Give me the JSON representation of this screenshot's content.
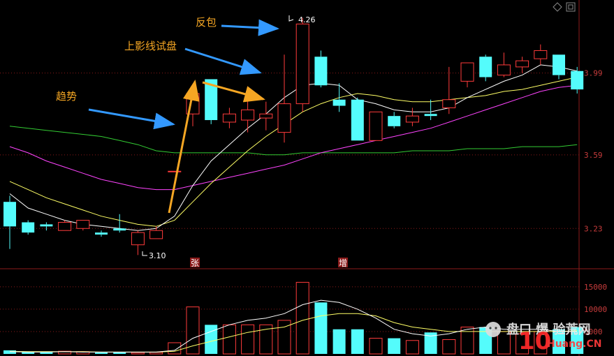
{
  "chart_data": {
    "type": "candlestick",
    "price_ylim": [
      3.05,
      4.32
    ],
    "price_ticks": [
      "3.99",
      "3.59",
      "3.23"
    ],
    "volume_ticks": [
      "15000",
      "10000",
      "5000"
    ],
    "candles": [
      {
        "o": 3.36,
        "h": 3.39,
        "l": 3.13,
        "c": 3.24
      },
      {
        "o": 3.26,
        "h": 3.27,
        "l": 3.2,
        "c": 3.21
      },
      {
        "o": 3.25,
        "h": 3.26,
        "l": 3.22,
        "c": 3.24
      },
      {
        "o": 3.22,
        "h": 3.27,
        "l": 3.22,
        "c": 3.26
      },
      {
        "o": 3.23,
        "h": 3.27,
        "l": 3.22,
        "c": 3.27
      },
      {
        "o": 3.21,
        "h": 3.22,
        "l": 3.19,
        "c": 3.2
      },
      {
        "o": 3.23,
        "h": 3.3,
        "l": 3.21,
        "c": 3.22
      },
      {
        "o": 3.15,
        "h": 3.22,
        "l": 3.1,
        "c": 3.21
      },
      {
        "o": 3.18,
        "h": 3.24,
        "l": 3.18,
        "c": 3.22
      },
      {
        "o": 3.51,
        "h": 3.51,
        "l": 3.51,
        "c": 3.51
      },
      {
        "o": 3.79,
        "h": 3.89,
        "l": 3.73,
        "c": 3.89
      },
      {
        "o": 3.96,
        "h": 3.96,
        "l": 3.74,
        "c": 3.76
      },
      {
        "o": 3.75,
        "h": 3.82,
        "l": 3.72,
        "c": 3.79
      },
      {
        "o": 3.76,
        "h": 3.87,
        "l": 3.7,
        "c": 3.81
      },
      {
        "o": 3.77,
        "h": 3.85,
        "l": 3.71,
        "c": 3.79
      },
      {
        "o": 3.7,
        "h": 4.08,
        "l": 3.65,
        "c": 3.84
      },
      {
        "o": 3.84,
        "h": 4.26,
        "l": 3.8,
        "c": 4.23
      },
      {
        "o": 4.07,
        "h": 4.1,
        "l": 3.92,
        "c": 3.93
      },
      {
        "o": 3.86,
        "h": 3.94,
        "l": 3.8,
        "c": 3.83
      },
      {
        "o": 3.86,
        "h": 3.87,
        "l": 3.66,
        "c": 3.66
      },
      {
        "o": 3.66,
        "h": 3.8,
        "l": 3.66,
        "c": 3.8
      },
      {
        "o": 3.78,
        "h": 3.8,
        "l": 3.72,
        "c": 3.73
      },
      {
        "o": 3.75,
        "h": 3.82,
        "l": 3.73,
        "c": 3.78
      },
      {
        "o": 3.79,
        "h": 3.86,
        "l": 3.76,
        "c": 3.78
      },
      {
        "o": 3.82,
        "h": 4.02,
        "l": 3.79,
        "c": 3.86
      },
      {
        "o": 3.95,
        "h": 4.04,
        "l": 3.92,
        "c": 4.04
      },
      {
        "o": 4.07,
        "h": 4.08,
        "l": 3.95,
        "c": 3.97
      },
      {
        "o": 3.98,
        "h": 4.09,
        "l": 3.97,
        "c": 4.03
      },
      {
        "o": 4.02,
        "h": 4.07,
        "l": 3.99,
        "c": 4.05
      },
      {
        "o": 4.06,
        "h": 4.13,
        "l": 4.03,
        "c": 4.1
      },
      {
        "o": 4.08,
        "h": 4.08,
        "l": 3.96,
        "c": 3.98
      },
      {
        "o": 4.0,
        "h": 4.02,
        "l": 3.89,
        "c": 3.91
      }
    ],
    "volumes": [
      800,
      500,
      400,
      600,
      500,
      300,
      400,
      300,
      350,
      2500,
      10500,
      6500,
      6500,
      6500,
      6500,
      7500,
      16000,
      11500,
      5500,
      5500,
      3500,
      3500,
      3000,
      4800,
      3200,
      6000,
      6000,
      5000,
      4500,
      5000,
      5500,
      6000
    ],
    "ma_white": [
      3.4,
      3.33,
      3.3,
      3.27,
      3.25,
      3.24,
      3.23,
      3.22,
      3.23,
      3.29,
      3.44,
      3.56,
      3.64,
      3.72,
      3.79,
      3.87,
      3.93,
      3.94,
      3.93,
      3.86,
      3.84,
      3.81,
      3.8,
      3.8,
      3.82,
      3.87,
      3.91,
      3.95,
      3.98,
      4.03,
      4.02,
      4.0
    ],
    "ma_yellow": [
      3.46,
      3.42,
      3.38,
      3.35,
      3.32,
      3.29,
      3.27,
      3.25,
      3.24,
      3.27,
      3.36,
      3.45,
      3.53,
      3.61,
      3.68,
      3.74,
      3.8,
      3.84,
      3.87,
      3.89,
      3.88,
      3.86,
      3.85,
      3.85,
      3.86,
      3.87,
      3.88,
      3.9,
      3.91,
      3.93,
      3.95,
      3.97
    ],
    "ma_magenta": [
      3.63,
      3.6,
      3.56,
      3.53,
      3.5,
      3.47,
      3.45,
      3.43,
      3.42,
      3.42,
      3.44,
      3.46,
      3.48,
      3.5,
      3.52,
      3.54,
      3.57,
      3.6,
      3.62,
      3.64,
      3.66,
      3.68,
      3.7,
      3.72,
      3.75,
      3.78,
      3.81,
      3.84,
      3.87,
      3.9,
      3.92,
      3.93
    ],
    "ma_green": [
      3.73,
      3.72,
      3.71,
      3.7,
      3.69,
      3.68,
      3.66,
      3.64,
      3.61,
      3.6,
      3.6,
      3.6,
      3.6,
      3.6,
      3.59,
      3.59,
      3.6,
      3.6,
      3.6,
      3.6,
      3.6,
      3.6,
      3.61,
      3.61,
      3.61,
      3.62,
      3.62,
      3.62,
      3.63,
      3.63,
      3.63,
      3.64
    ],
    "vol_ma_white": [
      500,
      400,
      400,
      500,
      400,
      400,
      400,
      400,
      400,
      800,
      3500,
      5000,
      6500,
      7500,
      8000,
      9000,
      11000,
      12000,
      11500,
      10000,
      8000,
      5500,
      4500,
      4000,
      4500,
      5500,
      6000,
      5500,
      5500,
      5500,
      5000,
      5000
    ],
    "vol_ma_yellow": [
      600,
      500,
      500,
      500,
      500,
      400,
      400,
      400,
      400,
      600,
      1800,
      2800,
      3800,
      4800,
      5500,
      6000,
      7500,
      8500,
      9000,
      9000,
      8500,
      7000,
      6000,
      5500,
      5000,
      5000,
      5000,
      5000,
      5000,
      5000,
      5000,
      5200
    ]
  },
  "annotations": {
    "trend": "趋势",
    "upper_shadow_test": "上影线试盘",
    "engulf": "反包",
    "high_marker": "4.26",
    "low_marker": "3.10",
    "zhang": "张",
    "zeng": "增"
  },
  "watermark": {
    "brand": "10",
    "site": "Huang.CN",
    "cn_text": "盘口 爆 验荒网"
  },
  "colors": {
    "up": "#FF3B3B",
    "down": "#54FCFC",
    "ma_white": "#FFFFFF",
    "ma_yellow": "#FFFF66",
    "ma_magenta": "#FF44FF",
    "ma_green": "#33CC33",
    "grid": "#8B1A1A",
    "annotation": "#F5A623",
    "arrow_blue": "#3399FF"
  }
}
